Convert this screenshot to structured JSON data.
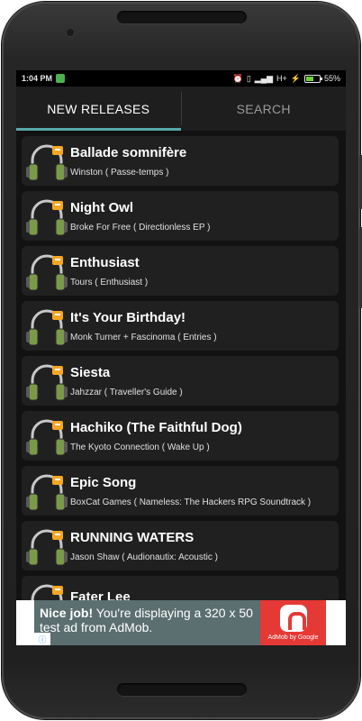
{
  "status_bar": {
    "time": "1:04 PM",
    "network": "H+",
    "battery_percent": "55%",
    "battery_level": 0.55
  },
  "tabs": [
    {
      "label": "NEW RELEASES",
      "active": true
    },
    {
      "label": "SEARCH",
      "active": false
    }
  ],
  "tracks": [
    {
      "title": "Ballade somnifère",
      "subtitle": "Winston ( Passe-temps )"
    },
    {
      "title": "Night Owl",
      "subtitle": "Broke For Free ( Directionless EP )"
    },
    {
      "title": "Enthusiast",
      "subtitle": "Tours ( Enthusiast )"
    },
    {
      "title": "It's Your Birthday!",
      "subtitle": "Monk Turner + Fascinoma ( Entries )"
    },
    {
      "title": "Siesta",
      "subtitle": "Jahzzar ( Traveller's Guide )"
    },
    {
      "title": "Hachiko (The Faithful Dog)",
      "subtitle": "The Kyoto Connection ( Wake Up )"
    },
    {
      "title": "Epic Song",
      "subtitle": "BoxCat Games ( Nameless: The Hackers RPG Soundtrack )"
    },
    {
      "title": "RUNNING WATERS",
      "subtitle": "Jason Shaw ( Audionautix: Acoustic )"
    },
    {
      "title": "Fater Lee",
      "subtitle": ""
    }
  ],
  "ad": {
    "headline": "Nice job!",
    "body": "You're displaying a 320 x 50 test ad from AdMob.",
    "brand": "AdMob by Google"
  },
  "colors": {
    "tab_indicator": "#58a8a8",
    "headphone_green": "#7a9a4a",
    "badge_orange": "#f5a623",
    "ad_bg": "#5b6e70",
    "ad_logo": "#e53935"
  }
}
